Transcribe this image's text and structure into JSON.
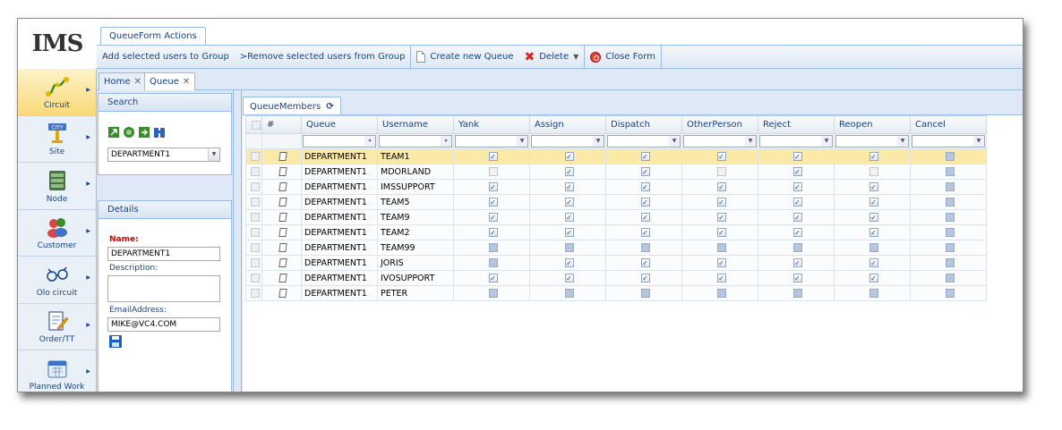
{
  "logo": "IMS",
  "ribbon": {
    "tab_label": "QueueForm Actions",
    "buttons": {
      "add_users": "Add selected users to Group",
      "remove_users": ">Remove selected users from Group",
      "create_queue": "Create new Queue",
      "delete": "Delete",
      "close_form": "Close Form"
    }
  },
  "nav": [
    {
      "label": "Circuit",
      "icon": "circuit-icon",
      "active": true
    },
    {
      "label": "Site",
      "icon": "city-site-icon"
    },
    {
      "label": "Node",
      "icon": "node-server-icon"
    },
    {
      "label": "Customer",
      "icon": "customer-people-icon"
    },
    {
      "label": "Olo circuit",
      "icon": "olo-circuit-icon"
    },
    {
      "label": "Order/TT",
      "icon": "order-pencil-icon"
    },
    {
      "label": "Planned Work",
      "icon": "calendar-icon"
    }
  ],
  "doc_tabs": [
    "Home",
    "Queue"
  ],
  "search_panel": {
    "title": "Search",
    "selected_queue": "DEPARTMENT1"
  },
  "details_panel": {
    "title": "Details",
    "name_label": "Name:",
    "name_value": "DEPARTMENT1",
    "description_label": "Description:",
    "description_value": "",
    "email_label": "EmailAddress:",
    "email_value": "MIKE@VC4.COM"
  },
  "grid": {
    "tab_label": "QueueMembers",
    "columns": [
      "#",
      "Queue",
      "Username",
      "Yank",
      "Assign",
      "Dispatch",
      "OtherPerson",
      "Reject",
      "Reopen",
      "Cancel"
    ],
    "rows": [
      {
        "queue": "DEPARTMENT1",
        "username": "TEAM1",
        "flags": [
          1,
          1,
          1,
          1,
          1,
          1,
          0
        ],
        "selected": true
      },
      {
        "queue": "DEPARTMENT1",
        "username": "MDORLAND",
        "flags": [
          2,
          1,
          1,
          2,
          1,
          2,
          0
        ]
      },
      {
        "queue": "DEPARTMENT1",
        "username": "IMSSUPPORT",
        "flags": [
          1,
          1,
          1,
          1,
          1,
          1,
          0
        ]
      },
      {
        "queue": "DEPARTMENT1",
        "username": "TEAM5",
        "flags": [
          1,
          1,
          1,
          1,
          1,
          1,
          0
        ]
      },
      {
        "queue": "DEPARTMENT1",
        "username": "TEAM9",
        "flags": [
          1,
          1,
          1,
          1,
          1,
          1,
          0
        ]
      },
      {
        "queue": "DEPARTMENT1",
        "username": "TEAM2",
        "flags": [
          1,
          1,
          1,
          1,
          1,
          1,
          0
        ]
      },
      {
        "queue": "DEPARTMENT1",
        "username": "TEAM99",
        "flags": [
          0,
          0,
          0,
          0,
          0,
          0,
          0
        ]
      },
      {
        "queue": "DEPARTMENT1",
        "username": "JORIS",
        "flags": [
          0,
          1,
          1,
          1,
          1,
          1,
          0
        ]
      },
      {
        "queue": "DEPARTMENT1",
        "username": "IVOSUPPORT",
        "flags": [
          1,
          1,
          1,
          1,
          1,
          1,
          0
        ]
      },
      {
        "queue": "DEPARTMENT1",
        "username": "PETER",
        "flags": [
          0,
          0,
          0,
          0,
          0,
          0,
          0
        ]
      }
    ]
  },
  "colors": {
    "accent": "#15428b",
    "border": "#99bbe8",
    "selected_row": "#fbe9a8"
  }
}
